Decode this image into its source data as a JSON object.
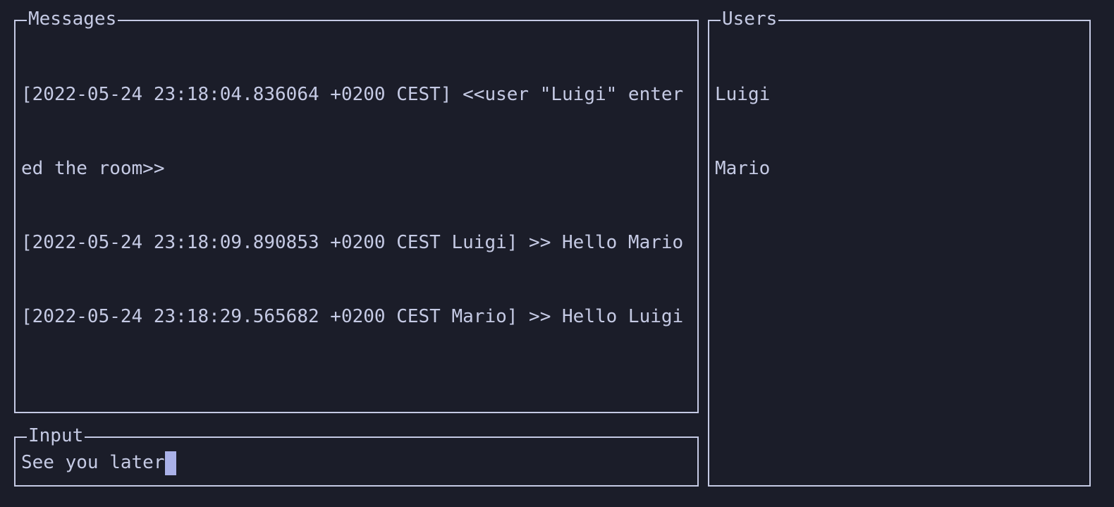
{
  "messages_pane": {
    "title": "Messages",
    "lines": [
      "[2022-05-24 23:18:04.836064 +0200 CEST] <<user \"Luigi\" enter",
      "ed the room>>",
      "[2022-05-24 23:18:09.890853 +0200 CEST Luigi] >> Hello Mario",
      "[2022-05-24 23:18:29.565682 +0200 CEST Mario] >> Hello Luigi"
    ]
  },
  "input_pane": {
    "title": "Input",
    "value": "See you later"
  },
  "users_pane": {
    "title": "Users",
    "users": [
      "Luigi",
      "Mario"
    ]
  },
  "colors": {
    "background": "#1b1d29",
    "foreground": "#c5cae4",
    "cursor": "#aab1e8"
  }
}
